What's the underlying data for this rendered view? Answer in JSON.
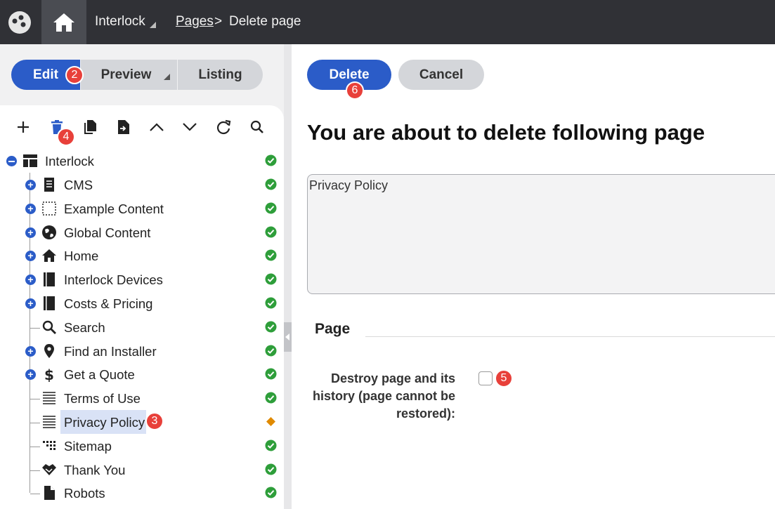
{
  "topbar": {
    "site_name": "Interlock",
    "breadcrumb_link": "Pages",
    "breadcrumb_separator": ">",
    "breadcrumb_current": "Delete page"
  },
  "mode_tabs": {
    "edit": "Edit",
    "preview": "Preview",
    "listing": "Listing"
  },
  "toolbar": {
    "icons": [
      "plus-icon",
      "trash-icon",
      "copy-icon",
      "move-icon",
      "arrow-up-icon",
      "arrow-down-icon",
      "refresh-icon",
      "search-icon"
    ]
  },
  "tree": {
    "root": "Interlock",
    "items": [
      {
        "label": "CMS",
        "icon": "document-icon",
        "expandable": true,
        "status": "published"
      },
      {
        "label": "Example Content",
        "icon": "dashed-box-icon",
        "expandable": true,
        "status": "published"
      },
      {
        "label": "Global Content",
        "icon": "globe-icon",
        "expandable": true,
        "status": "published"
      },
      {
        "label": "Home",
        "icon": "home-icon",
        "expandable": true,
        "status": "published"
      },
      {
        "label": "Interlock Devices",
        "icon": "book-icon",
        "expandable": true,
        "status": "published"
      },
      {
        "label": "Costs & Pricing",
        "icon": "book-icon",
        "expandable": true,
        "status": "published"
      },
      {
        "label": "Search",
        "icon": "search-icon",
        "expandable": false,
        "status": "published"
      },
      {
        "label": "Find an Installer",
        "icon": "map-pin-icon",
        "expandable": true,
        "status": "published"
      },
      {
        "label": "Get a Quote",
        "icon": "dollar-icon",
        "expandable": true,
        "status": "published"
      },
      {
        "label": "Terms of Use",
        "icon": "lines-icon",
        "expandable": false,
        "status": "published"
      },
      {
        "label": "Privacy Policy",
        "icon": "lines-icon",
        "expandable": false,
        "status": "modified"
      },
      {
        "label": "Sitemap",
        "icon": "grid-icon",
        "expandable": false,
        "status": "published"
      },
      {
        "label": "Thank You",
        "icon": "handshake-icon",
        "expandable": false,
        "status": "published"
      },
      {
        "label": "Robots",
        "icon": "file-icon",
        "expandable": false,
        "status": "published"
      }
    ]
  },
  "badges": {
    "edit": "2",
    "selected_page": "3",
    "delete_tool": "4",
    "destroy_checkbox": "5",
    "delete_button": "6"
  },
  "actions": {
    "delete": "Delete",
    "cancel": "Cancel"
  },
  "content": {
    "heading": "You are about to delete following page",
    "page_name": "Privacy Policy",
    "section_title": "Page",
    "destroy_label": "Destroy page and its history (page cannot be restored):",
    "destroy_checked": false
  },
  "colors": {
    "accent": "#2b5cc8",
    "topbar": "#303136",
    "published": "#2e9e3a",
    "modified": "#e08a00",
    "badge": "#e8403a"
  }
}
